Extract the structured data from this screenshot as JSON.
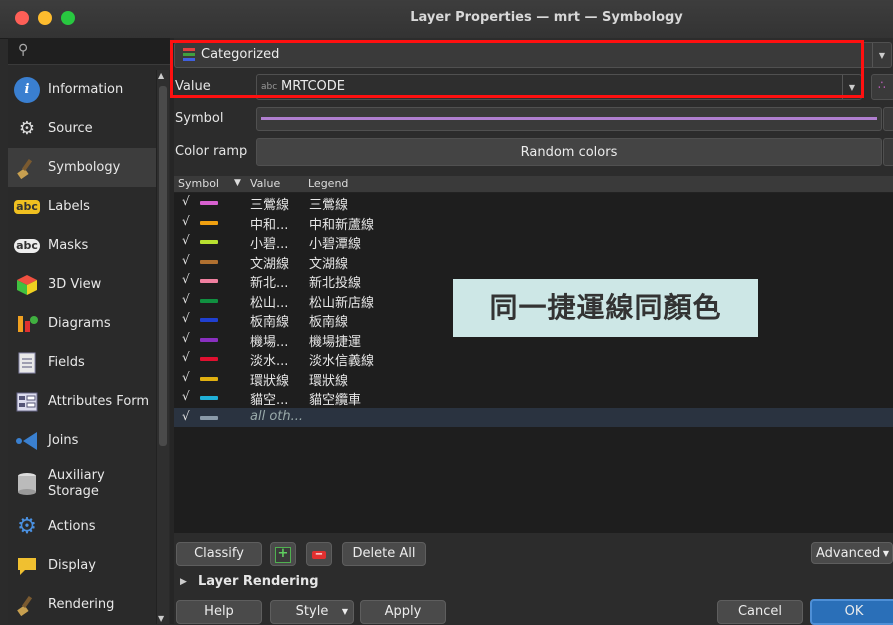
{
  "window": {
    "title": "Layer Properties — mrt — Symbology"
  },
  "sidebar": {
    "search_icon": "search-icon",
    "items": [
      {
        "label": "Information",
        "icon": "info-icon"
      },
      {
        "label": "Source",
        "icon": "source-icon"
      },
      {
        "label": "Symbology",
        "icon": "paintbrush-icon"
      },
      {
        "label": "Labels",
        "icon": "labels-icon",
        "glyph": "abc"
      },
      {
        "label": "Masks",
        "icon": "masks-icon",
        "glyph": "abc"
      },
      {
        "label": "3D View",
        "icon": "cube-icon"
      },
      {
        "label": "Diagrams",
        "icon": "diagrams-icon"
      },
      {
        "label": "Fields",
        "icon": "fields-icon"
      },
      {
        "label": "Attributes Form",
        "icon": "form-icon"
      },
      {
        "label": "Joins",
        "icon": "joins-icon"
      },
      {
        "label": "Auxiliary",
        "label2": "Storage",
        "icon": "database-icon"
      },
      {
        "label": "Actions",
        "icon": "gear-icon"
      },
      {
        "label": "Display",
        "icon": "speech-bubble-icon"
      },
      {
        "label": "Rendering",
        "icon": "paintbrush-icon"
      }
    ]
  },
  "renderer": {
    "value": "Categorized"
  },
  "value_field": {
    "label": "Value",
    "type_tag": "abc",
    "value": "MRTCODE"
  },
  "symbol": {
    "label": "Symbol",
    "color": "#b07fd0"
  },
  "color_ramp": {
    "label": "Color ramp",
    "value": "Random colors"
  },
  "table": {
    "headers": {
      "symbol": "Symbol",
      "value": "Value",
      "legend": "Legend"
    },
    "rows": [
      {
        "value": "三鶯線",
        "legend": "三鶯線",
        "color": "#d861d0"
      },
      {
        "value": "中和...",
        "legend": "中和新蘆線",
        "color": "#f0a010"
      },
      {
        "value": "小碧...",
        "legend": "小碧潭線",
        "color": "#b8e030"
      },
      {
        "value": "文湖線",
        "legend": "文湖線",
        "color": "#b07030"
      },
      {
        "value": "新北...",
        "legend": "新北投線",
        "color": "#f080a0"
      },
      {
        "value": "松山...",
        "legend": "松山新店線",
        "color": "#109040"
      },
      {
        "value": "板南線",
        "legend": "板南線",
        "color": "#2040d0"
      },
      {
        "value": "機場...",
        "legend": "機場捷運",
        "color": "#8a30c0"
      },
      {
        "value": "淡水...",
        "legend": "淡水信義線",
        "color": "#e01030"
      },
      {
        "value": "環狀線",
        "legend": "環狀線",
        "color": "#e0b010"
      },
      {
        "value": "貓空...",
        "legend": "貓空纜車",
        "color": "#20b0d8"
      },
      {
        "value": "all oth...",
        "legend": "",
        "color": "#8a9aa8"
      }
    ]
  },
  "callout": {
    "text": "同一捷運線同顏色"
  },
  "buttons": {
    "classify": "Classify",
    "add": "+",
    "remove": "−",
    "delete_all": "Delete All",
    "advanced": "Advanced",
    "layer_rendering": "Layer Rendering",
    "help": "Help",
    "style": "Style",
    "apply": "Apply",
    "cancel": "Cancel",
    "ok": "OK"
  }
}
